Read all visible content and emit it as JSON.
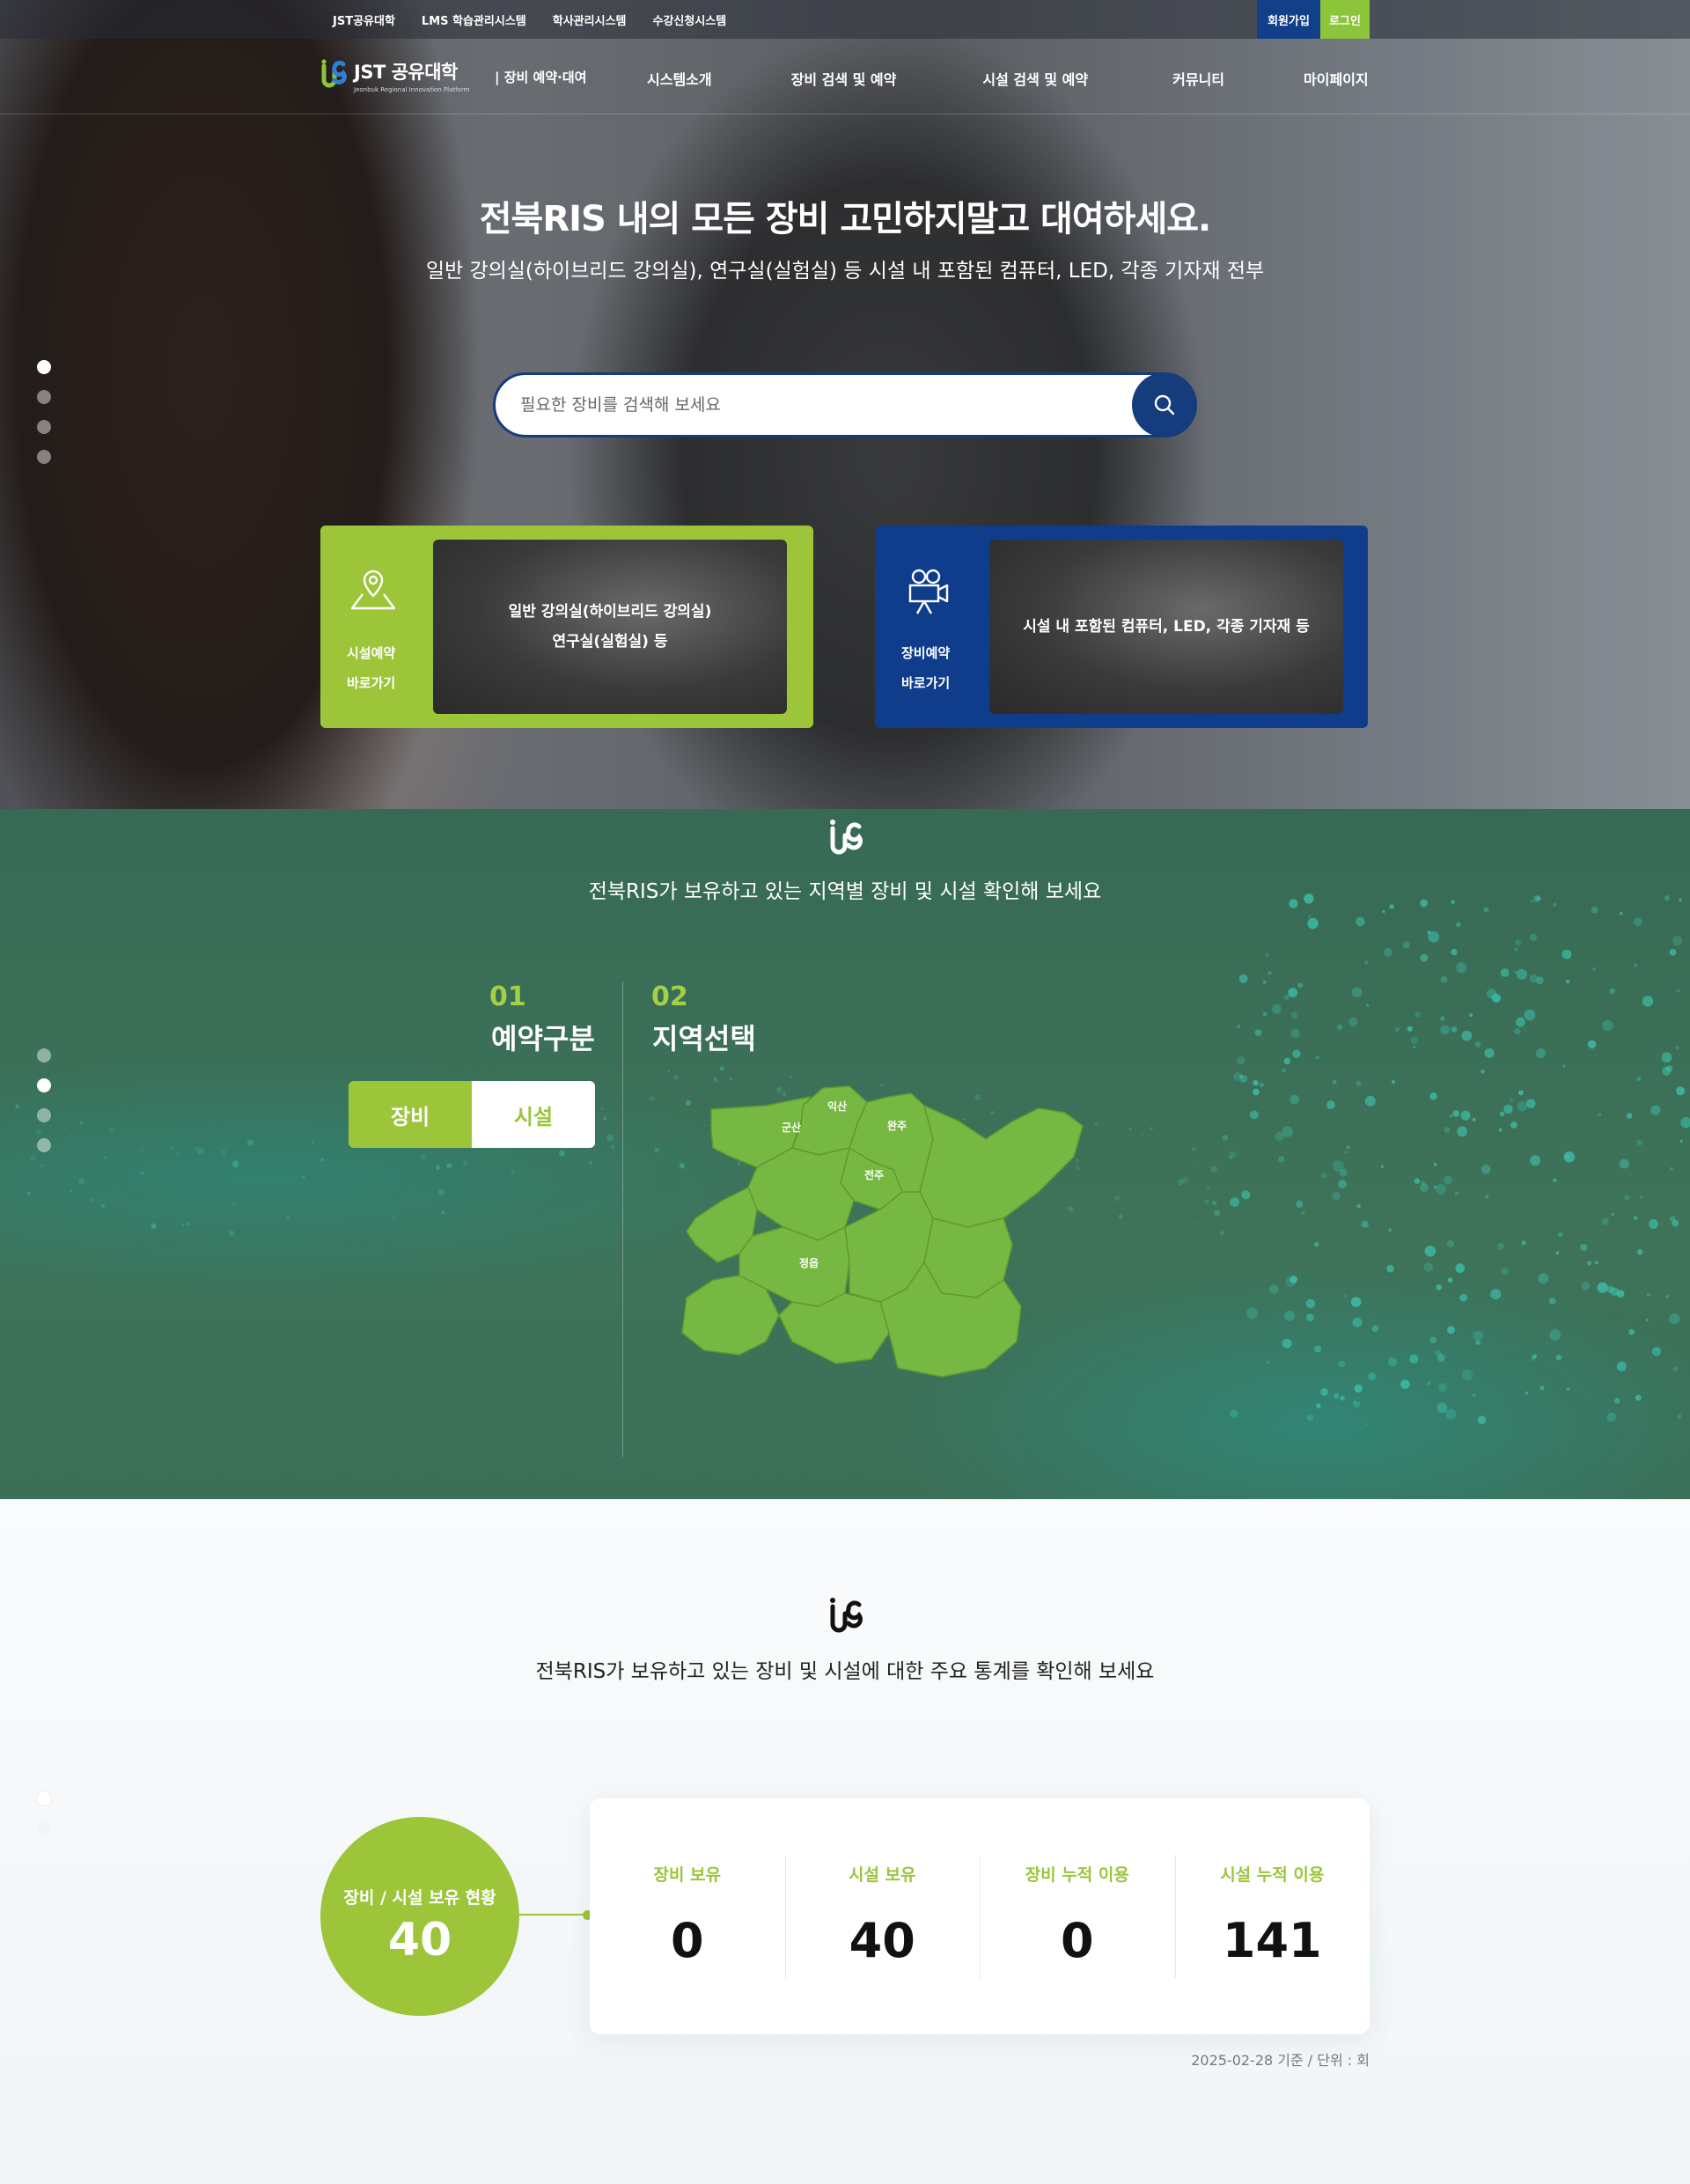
{
  "topbar": {
    "links": [
      "JST공유대학",
      "LMS 학습관리시스템",
      "학사관리시스템",
      "수강신청시스템"
    ],
    "join_label": "회원가입",
    "login_label": "로그인"
  },
  "header": {
    "logo_title": "JST 공유대학",
    "logo_sub": "Jeonbuk Regional Innovation Platform",
    "tagline": "| 장비 예약·대여",
    "menu": [
      "시스템소개",
      "장비 검색 및 예약",
      "시설 검색 및 예약",
      "커뮤니티",
      "마이페이지"
    ]
  },
  "hero": {
    "title": "전북RIS 내의 모든 장비 고민하지말고 대여하세요.",
    "subtitle": "일반 강의실(하이브리드 강의실), 연구실(실험실) 등 시설 내 포함된 컴퓨터, LED, 각종 기자재 전부",
    "search": {
      "placeholder": "필요한 장비를 검색해 보세요",
      "icon": "search-icon"
    },
    "quick_links": [
      {
        "label_1": "시설예약",
        "label_2": "바로가기",
        "caption": "일반 강의실(하이브리드 강의실)\n연구실(실험실) 등",
        "icon": "map-pin-icon",
        "color": "#9cc53a"
      },
      {
        "label_1": "장비예약",
        "label_2": "바로가기",
        "caption": "시설 내 포함된 컴퓨터, LED, 각종 기자재 등",
        "icon": "video-camera-icon",
        "color": "#0f3d8c"
      }
    ]
  },
  "map_section": {
    "title": "전북RIS가 보유하고 있는 지역별 장비 및 시설 확인해 보세요",
    "step1": {
      "num": "01",
      "name": "예약구분"
    },
    "step2": {
      "num": "02",
      "name": "지역선택"
    },
    "toggle": {
      "options": [
        "장비",
        "시설"
      ],
      "selected": "장비"
    },
    "regions": [
      "익산",
      "군산",
      "완주",
      "전주",
      "정읍"
    ],
    "map_color": "#77b843"
  },
  "stats_section": {
    "title": "전북RIS가 보유하고 있는 장비 및 시설에 대한 주요 통계를 확인해 보세요",
    "summary": {
      "label": "장비 / 시설 보유 현황",
      "value": "40"
    },
    "items": [
      {
        "label": "장비 보유",
        "value": "0"
      },
      {
        "label": "시설 보유",
        "value": "40"
      },
      {
        "label": "장비 누적 이용",
        "value": "0"
      },
      {
        "label": "시설 누적 이용",
        "value": "141"
      }
    ],
    "note": "2025-02-28 기준 / 단위 : 회"
  },
  "colors": {
    "green": "#9cc53a",
    "navy": "#153c7c",
    "map_bg": "#3c6f58"
  }
}
